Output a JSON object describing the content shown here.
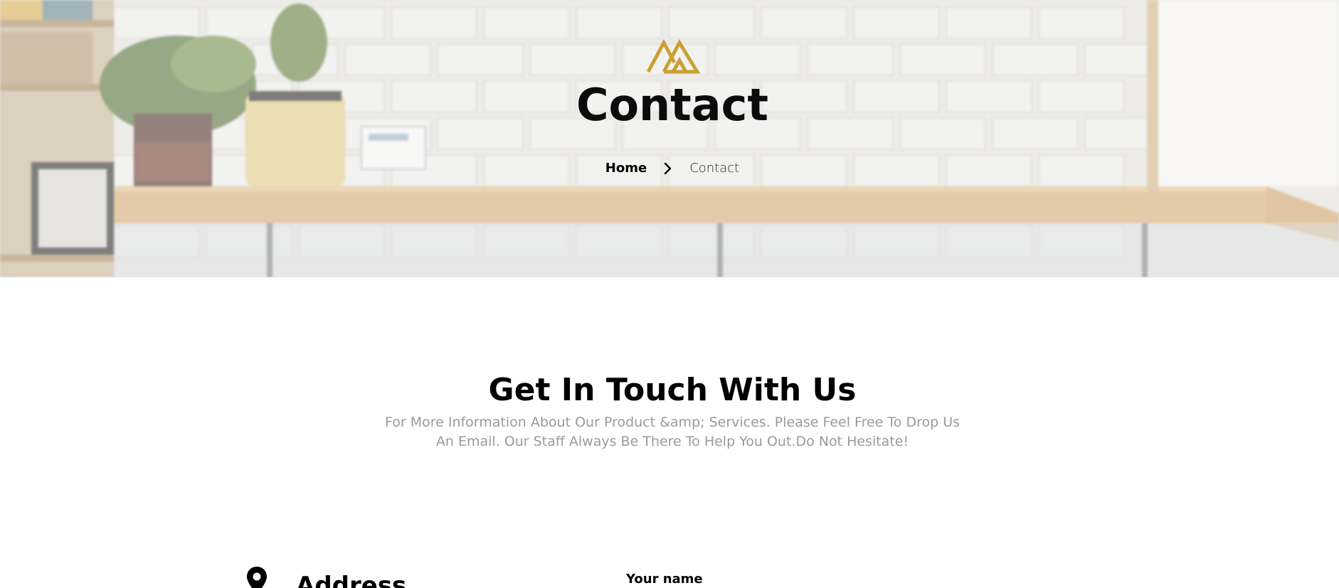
{
  "hero": {
    "title": "Contact",
    "logo_icon": "gold-m-logo",
    "logo_color": "#c9a133"
  },
  "breadcrumb": {
    "home_label": "Home",
    "separator_icon": "chevron-right-icon",
    "current_label": "Contact"
  },
  "touch": {
    "title": "Get In Touch With Us",
    "description": "For More Information About Our Product &amp; Services. Please Feel Free To Drop Us An Email. Our Staff Always Be There To Help You Out.Do Not Hesitate!"
  },
  "info": {
    "address_icon": "map-pin-icon",
    "address_heading": "Address"
  },
  "form": {
    "name_label": "Your name"
  }
}
